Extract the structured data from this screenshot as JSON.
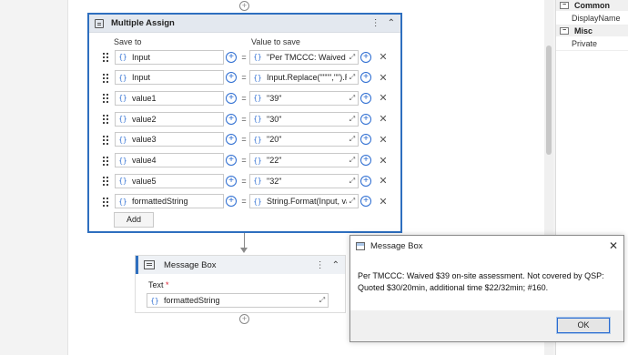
{
  "multiple_assign": {
    "title": "Multiple Assign",
    "menu_icon": "⋮",
    "collapse_icon": "⌃",
    "save_to_header": "Save to",
    "value_header": "Value to save",
    "rows": [
      {
        "save_to": "Input",
        "value": "\"Per TMCCC: Waived $"
      },
      {
        "save_to": "Input",
        "value": "Input.Replace(\"\"\"\",\"\").Re"
      },
      {
        "save_to": "value1",
        "value": "\"39\""
      },
      {
        "save_to": "value2",
        "value": "\"30\""
      },
      {
        "save_to": "value3",
        "value": "\"20\""
      },
      {
        "save_to": "value4",
        "value": "\"22\""
      },
      {
        "save_to": "value5",
        "value": "\"32\""
      },
      {
        "save_to": "formattedString",
        "value": "String.Format(Input, va"
      }
    ],
    "add_label": "Add"
  },
  "message_box": {
    "title": "Message Box",
    "menu_icon": "⋮",
    "collapse_icon": "⌃",
    "text_label": "Text",
    "required_marker": "*",
    "text_value": "formattedString"
  },
  "properties": {
    "groups": [
      {
        "name": "Common",
        "toggle": "−",
        "items": [
          "DisplayName"
        ]
      },
      {
        "name": "Misc",
        "toggle": "−",
        "items": [
          "Private"
        ]
      }
    ]
  },
  "dialog": {
    "title": "Message Box",
    "close_glyph": "✕",
    "message": "Per TMCCC: Waived $39 on-site assessment. Not covered by QSP: Quoted $30/20min, additional time $22/32min; #160.",
    "ok_label": "OK"
  },
  "glyphs": {
    "fx": "{}",
    "expand": "⤢",
    "plus": "+",
    "eq": "=",
    "delete": "✕"
  }
}
